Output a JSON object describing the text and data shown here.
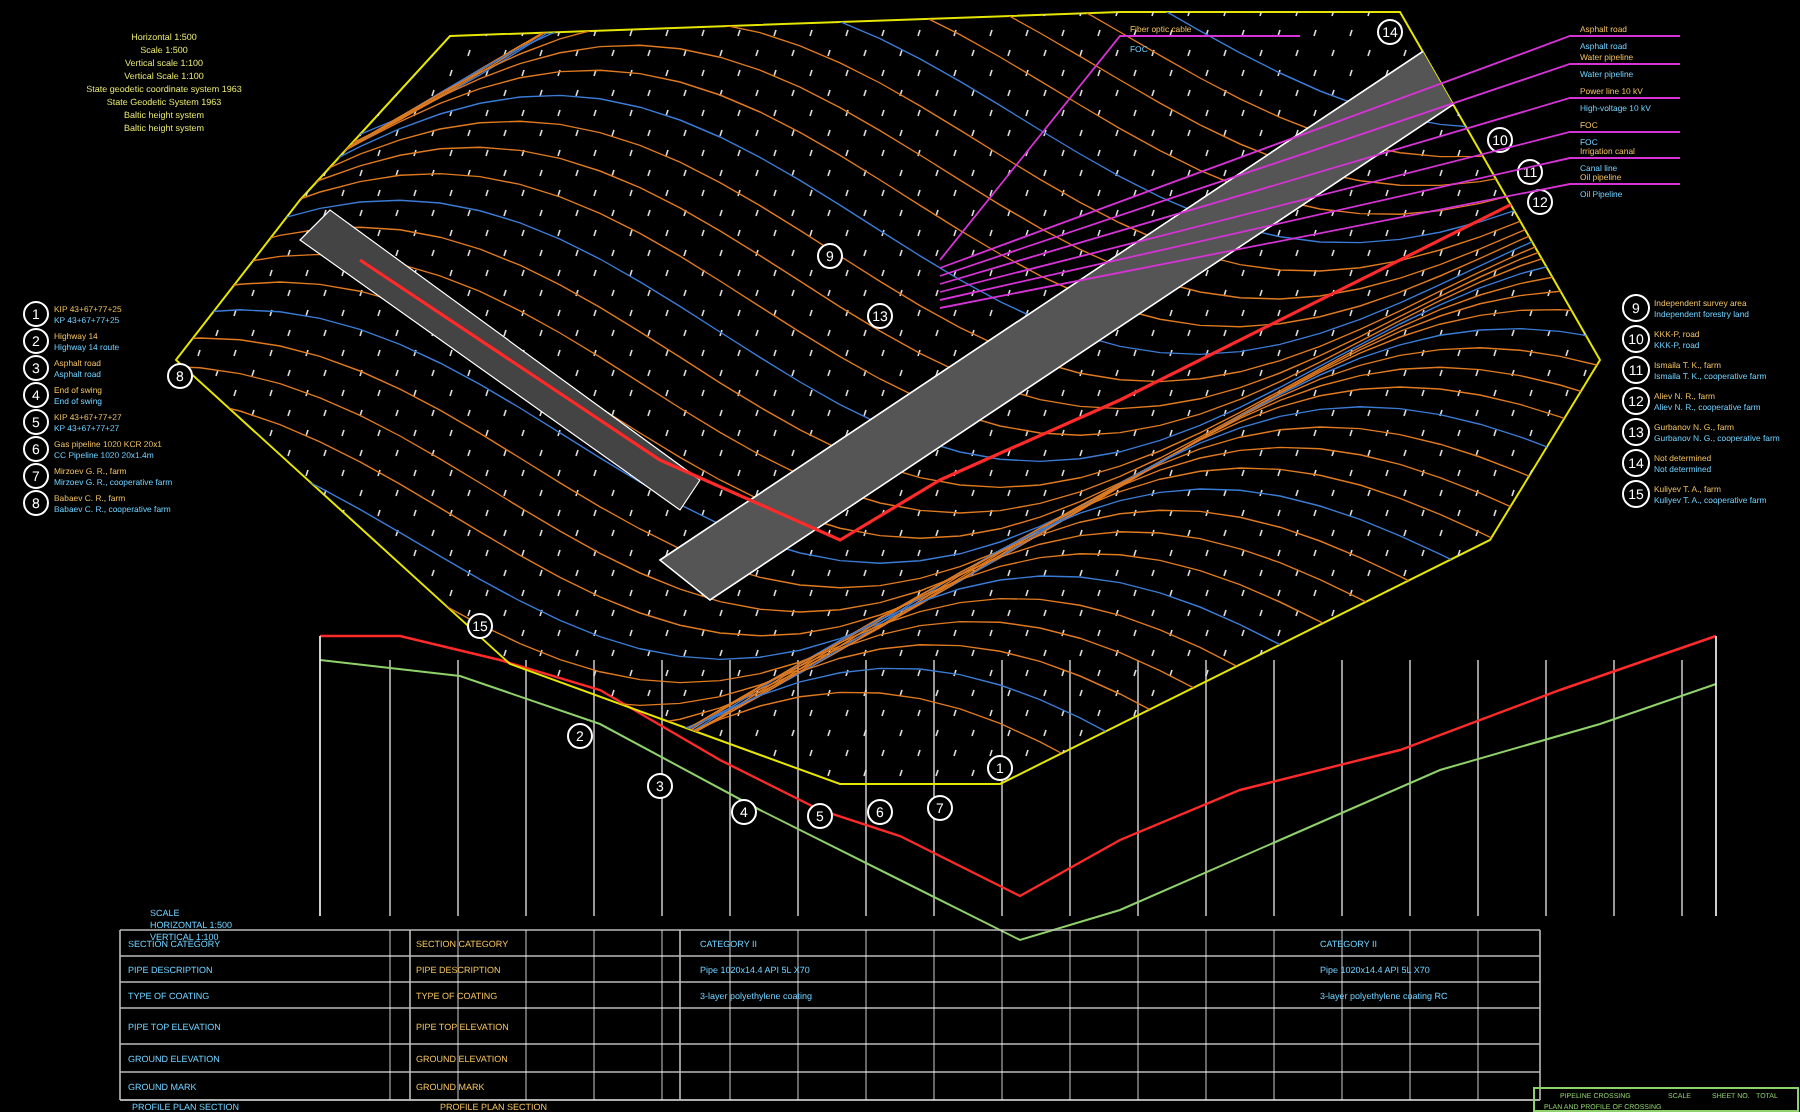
{
  "notes": [
    "Horizontal 1:500",
    "Scale 1:500",
    "Vertical scale 1:100",
    "Vertical Scale 1:100",
    "State geodetic coordinate system 1963",
    "State Geodetic System 1963",
    "Baltic height system",
    "Baltic height system"
  ],
  "legend_left": [
    {
      "number": "1",
      "title": "KIP 43+67+77+25",
      "subtitle": "KP 43+67+77+25"
    },
    {
      "number": "2",
      "title": "Highway 14",
      "subtitle": "Highway 14 route"
    },
    {
      "number": "3",
      "title": "Asphalt road",
      "subtitle": "Asphalt road"
    },
    {
      "number": "4",
      "title": "End of swing",
      "subtitle": "End of swing"
    },
    {
      "number": "5",
      "title": "KIP 43+67+77+27",
      "subtitle": "KP 43+67+77+27"
    },
    {
      "number": "6",
      "title": "Gas pipeline 1020 KCR 20x1",
      "subtitle": "CC Pipeline 1020 20x1.4m"
    },
    {
      "number": "7",
      "title": "Mirzoev G. R., farm",
      "subtitle": "Mirzoev G. R., cooperative farm"
    },
    {
      "number": "8",
      "title": "Babaev C. R., farm",
      "subtitle": "Babaev C. R., cooperative farm"
    }
  ],
  "legend_right": [
    {
      "number": "9",
      "title": "Independent survey area",
      "subtitle": "Independent forestry land"
    },
    {
      "number": "10",
      "title": "KKK-P, road",
      "subtitle": "KKK-P, road"
    },
    {
      "number": "11",
      "title": "Ismaila T. K., farm",
      "subtitle": "Ismaila T. K., cooperative farm"
    },
    {
      "number": "12",
      "title": "Aliev N. R., farm",
      "subtitle": "Aliev N. R., cooperative farm"
    },
    {
      "number": "13",
      "title": "Gurbanov N. G., farm",
      "subtitle": "Gurbanov N. G., cooperative farm"
    },
    {
      "number": "14",
      "title": "Not determined",
      "subtitle": "Not determined"
    },
    {
      "number": "15",
      "title": "Kuliyev T. A., farm",
      "subtitle": "Kuliyev T. A., cooperative farm"
    }
  ],
  "leaders": [
    {
      "title": "Fiber optic cable",
      "subtitle": "FOC"
    },
    {
      "title": "Asphalt road",
      "subtitle": "Asphalt road"
    },
    {
      "title": "Water pipeline",
      "subtitle": "Water pipeline"
    },
    {
      "title": "Power line 10 kV",
      "subtitle": "High-voltage 10 kV"
    },
    {
      "title": "FOC",
      "subtitle": "FOC"
    },
    {
      "title": "Irrigation canal",
      "subtitle": "Canal line"
    },
    {
      "title": "Oil pipeline",
      "subtitle": "Oil Pipeline"
    }
  ],
  "callouts": [
    "1",
    "2",
    "3",
    "4",
    "5",
    "6",
    "7",
    "8",
    "9",
    "10",
    "11",
    "12",
    "13",
    "14",
    "15"
  ],
  "profile_header": [
    "SCALE",
    "HORIZONTAL 1:500",
    "VERTICAL 1:100"
  ],
  "table_rows": [
    {
      "label": "SECTION CATEGORY",
      "value": "SECTION CATEGORY",
      "segments": [
        "CATEGORY II",
        "CATEGORY II"
      ]
    },
    {
      "label": "PIPE DESCRIPTION",
      "value": "PIPE DESCRIPTION",
      "segments": [
        "Pipe 1020x14.4 API 5L X70",
        "Pipe 1020x14.4 API 5L X70"
      ]
    },
    {
      "label": "TYPE OF COATING",
      "value": "TYPE OF COATING",
      "segments": [
        "3-layer polyethylene coating",
        "3-layer polyethylene coating RC"
      ]
    },
    {
      "label": "PIPE TOP ELEVATION",
      "value": "PIPE TOP ELEVATION",
      "segments": []
    },
    {
      "label": "GROUND ELEVATION",
      "value": "GROUND ELEVATION",
      "segments": []
    },
    {
      "label": "GROUND MARK",
      "value": "GROUND MARK",
      "segments": []
    }
  ],
  "table_footer": [
    "PROFILE PLAN SECTION",
    "PROFILE PLAN SECTION"
  ],
  "title_block": {
    "title": "PIPELINE CROSSING",
    "subtitle": "PLAN AND PROFILE OF CROSSING",
    "cells": [
      "SCALE",
      "SHEET NO.",
      "TOTAL"
    ]
  }
}
